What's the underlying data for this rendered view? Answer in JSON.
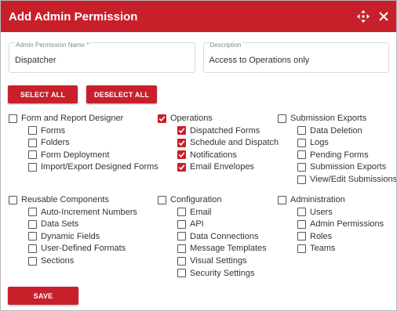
{
  "dialog": {
    "title": "Add Admin Permission"
  },
  "fields": {
    "name": {
      "label": "Admin Permission Name *",
      "value": "Dispatcher"
    },
    "description": {
      "label": "Description",
      "value": "Access to Operations only"
    }
  },
  "buttons": {
    "select_all": "SELECT ALL",
    "deselect_all": "DESELECT ALL",
    "save": "SAVE"
  },
  "colors": {
    "accent": "#c8202b"
  },
  "groups": [
    {
      "label": "Form and Report Designer",
      "checked": false,
      "items": [
        {
          "label": "Forms",
          "checked": false
        },
        {
          "label": "Folders",
          "checked": false
        },
        {
          "label": "Form Deployment",
          "checked": false
        },
        {
          "label": "Import/Export Designed Forms",
          "checked": false
        }
      ]
    },
    {
      "label": "Operations",
      "checked": true,
      "items": [
        {
          "label": "Dispatched Forms",
          "checked": true
        },
        {
          "label": "Schedule and Dispatch",
          "checked": true
        },
        {
          "label": "Notifications",
          "checked": true
        },
        {
          "label": "Email Envelopes",
          "checked": true
        }
      ]
    },
    {
      "label": "Submission Exports",
      "checked": false,
      "items": [
        {
          "label": "Data Deletion",
          "checked": false
        },
        {
          "label": "Logs",
          "checked": false
        },
        {
          "label": "Pending Forms",
          "checked": false
        },
        {
          "label": "Submission Exports",
          "checked": false
        },
        {
          "label": "View/Edit Submissions",
          "checked": false
        }
      ]
    },
    {
      "label": "Reusable Components",
      "checked": false,
      "items": [
        {
          "label": "Auto-Increment Numbers",
          "checked": false
        },
        {
          "label": "Data Sets",
          "checked": false
        },
        {
          "label": "Dynamic Fields",
          "checked": false
        },
        {
          "label": "User-Defined Formats",
          "checked": false
        },
        {
          "label": "Sections",
          "checked": false
        }
      ]
    },
    {
      "label": "Configuration",
      "checked": false,
      "items": [
        {
          "label": "Email",
          "checked": false
        },
        {
          "label": "API",
          "checked": false
        },
        {
          "label": "Data Connections",
          "checked": false
        },
        {
          "label": "Message Templates",
          "checked": false
        },
        {
          "label": "Visual Settings",
          "checked": false
        },
        {
          "label": "Security Settings",
          "checked": false
        }
      ]
    },
    {
      "label": "Administration",
      "checked": false,
      "items": [
        {
          "label": "Users",
          "checked": false
        },
        {
          "label": "Admin Permissions",
          "checked": false
        },
        {
          "label": "Roles",
          "checked": false
        },
        {
          "label": "Teams",
          "checked": false
        }
      ]
    }
  ]
}
